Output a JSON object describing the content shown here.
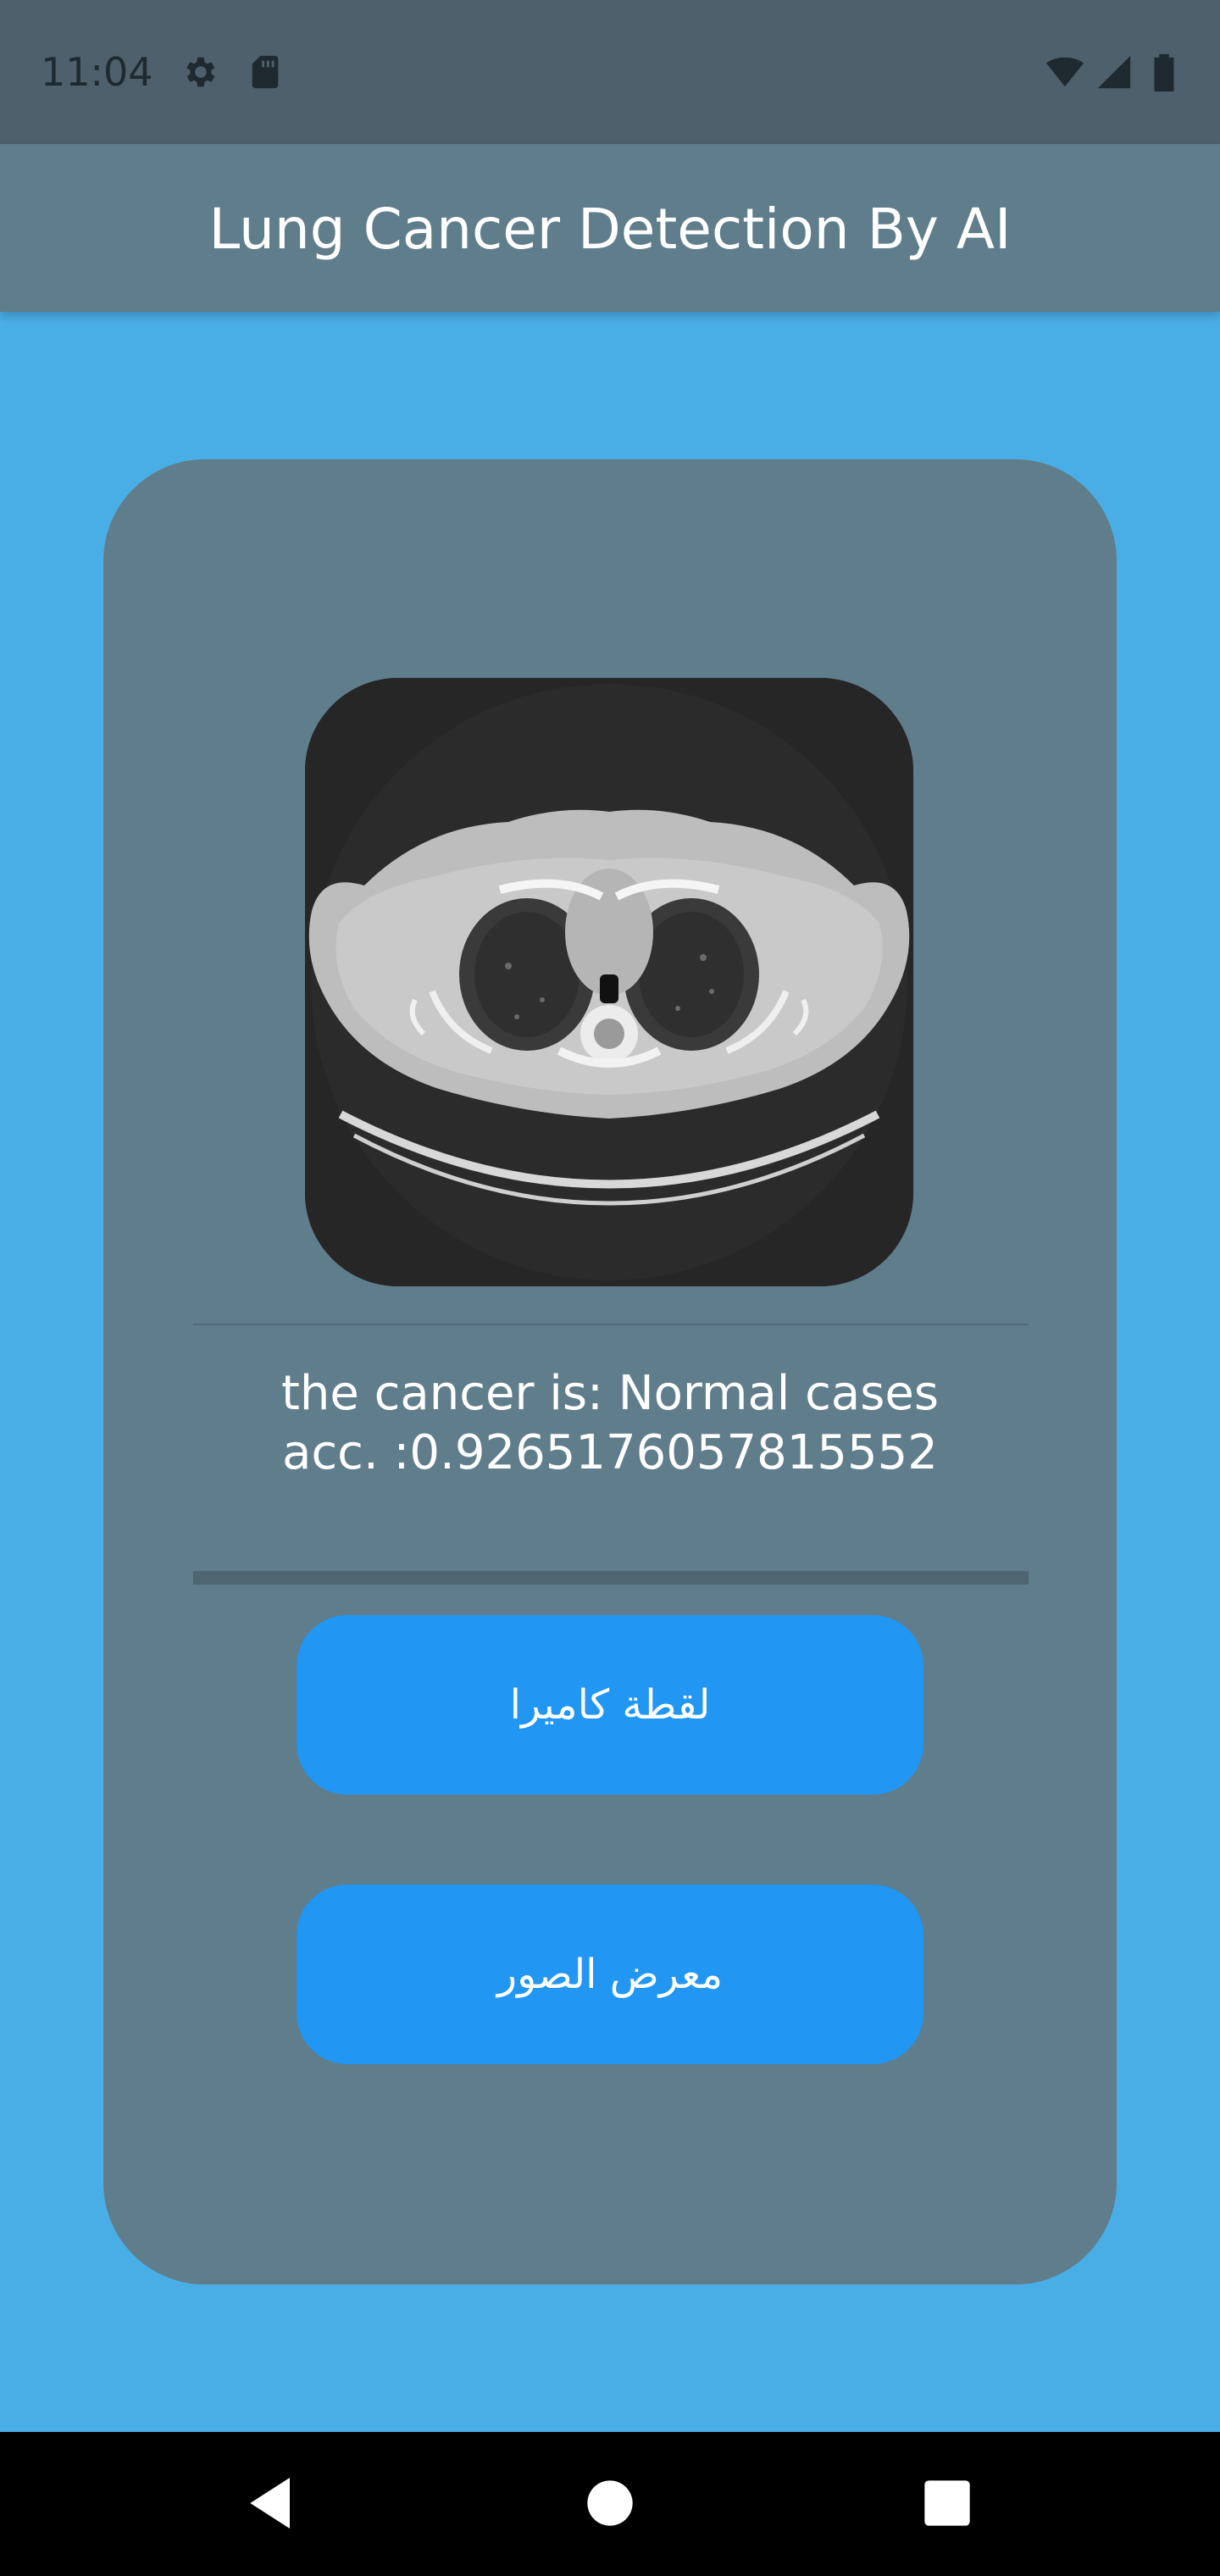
{
  "status_bar": {
    "time": "11:04",
    "icons": [
      "gear-icon",
      "sd-card-icon",
      "wifi-icon",
      "signal-icon",
      "battery-icon"
    ]
  },
  "app_bar": {
    "title": "Lung Cancer Detection By AI"
  },
  "result": {
    "line1": "the cancer is: Normal cases",
    "line2": "acc. :0.9265176057815552"
  },
  "buttons": {
    "camera_label": "لقطة كاميرا",
    "gallery_label": "معرض الصور"
  },
  "nav_bar": {
    "icons": [
      "back-icon",
      "home-icon",
      "recents-icon"
    ]
  },
  "colors": {
    "background": "#4aaee6",
    "app_bar": "#607d8b",
    "card": "#607d8b",
    "button": "#2196f3",
    "status_bar": "#4d606b"
  }
}
